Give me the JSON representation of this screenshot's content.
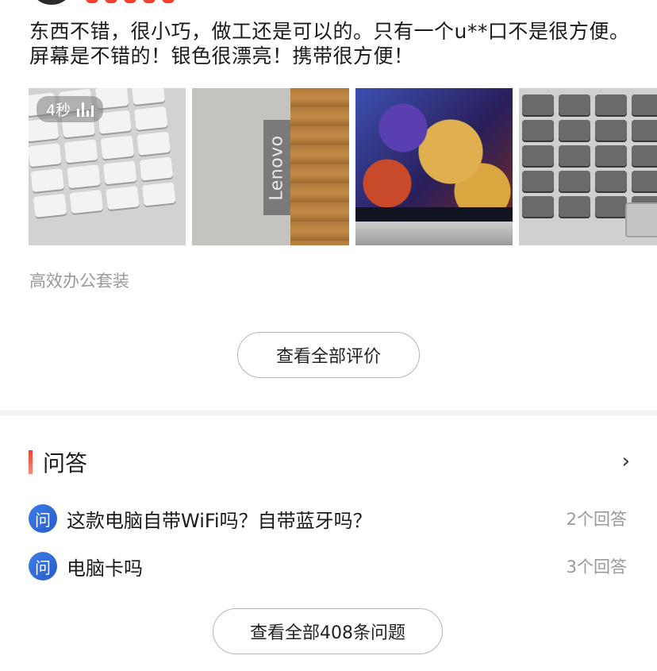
{
  "review": {
    "text": "东西不错，很小巧，做工还是可以的。只有一个u**口不是很方便。屏幕是不错的！银色很漂亮！携带很方便！",
    "rating_stars": 5,
    "video_duration": "4秒",
    "photo_logo_text": "Lenovo",
    "tag": "高效办公套装"
  },
  "reviews_button": "查看全部评价",
  "qa": {
    "title": "问答",
    "items": [
      {
        "icon": "问",
        "question": "这款电脑自带WiFi吗？自带蓝牙吗？",
        "answers": "2个回答"
      },
      {
        "icon": "问",
        "question": "电脑卡吗",
        "answers": "3个回答"
      }
    ],
    "all_button": "查看全部408条问题"
  },
  "colors": {
    "accent": "#f0412e",
    "question_icon": "#2a5cc8",
    "muted_text": "#999999"
  }
}
